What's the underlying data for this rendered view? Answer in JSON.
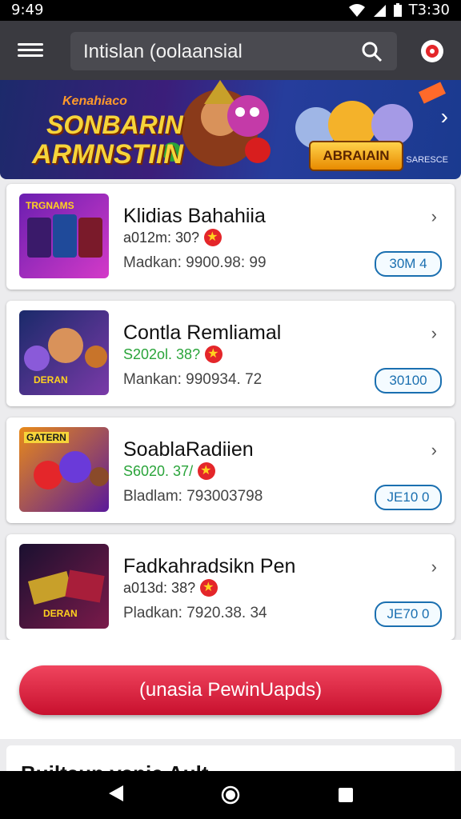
{
  "status": {
    "time": "9:49",
    "clock_right": "T3:30"
  },
  "header": {
    "search_text": "Intislan (oolaansial"
  },
  "banner": {
    "line1": "Kenahiaco",
    "line2": "SONBARIN",
    "line3": "ARMNSTIIN",
    "logo": "ABRAIAIN",
    "small": "SARESCE"
  },
  "games": [
    {
      "title": "Klidias Bahahiia",
      "stat": "a012m: 30?",
      "stat_color": "dark",
      "detail": "Madkan: 9900.98: 99",
      "button": "30M 4",
      "thumb_label": "TRGNAMS"
    },
    {
      "title": "Contla Remliamal",
      "stat": "S202ol. 38?",
      "stat_color": "green",
      "detail": "Mankan: 990934. 72",
      "button": "30100",
      "thumb_label": "DERAN"
    },
    {
      "title": "SoablaRadiien",
      "stat": "S6020. 37/",
      "stat_color": "green",
      "detail": "Bladlam: 7930037​98",
      "button": "JE10 0",
      "thumb_label": "GATERN"
    },
    {
      "title": "Fadkahradsikn Pen",
      "stat": "a013d: 38?",
      "stat_color": "dark",
      "detail": "Pladkan: 7920.38. 34",
      "button": "JE70 0",
      "thumb_label": "DERAN"
    }
  ],
  "cta": {
    "label": "(unasia PewinUapds)"
  },
  "partial": {
    "label": "Builtaun vanie Ault"
  },
  "colors": {
    "accent": "#c8102e",
    "link": "#1a6fb0",
    "appbar": "#3a3a40"
  }
}
